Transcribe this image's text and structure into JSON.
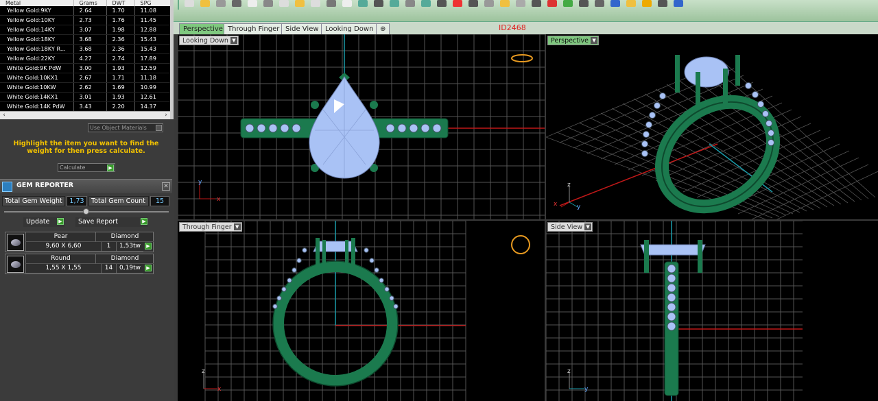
{
  "metal_table": {
    "headers": [
      "Metal",
      "Grams",
      "DWT",
      "SPG"
    ],
    "rows": [
      [
        "Yellow Gold:9KY",
        "2.64",
        "1.70",
        "11.08"
      ],
      [
        "Yellow Gold:10KY",
        "2.73",
        "1.76",
        "11.45"
      ],
      [
        "Yellow Gold:14KY",
        "3.07",
        "1.98",
        "12.88"
      ],
      [
        "Yellow Gold:18KY",
        "3.68",
        "2.36",
        "15.43"
      ],
      [
        "Yellow Gold:18KY R...",
        "3.68",
        "2.36",
        "15.43"
      ],
      [
        "Yellow Gold:22KY",
        "4.27",
        "2.74",
        "17.89"
      ],
      [
        "White Gold:9K PdW",
        "3.00",
        "1.93",
        "12.59"
      ],
      [
        "White Gold:10KX1",
        "2.67",
        "1.71",
        "11.18"
      ],
      [
        "White Gold:10KW",
        "2.62",
        "1.69",
        "10.99"
      ],
      [
        "White Gold:14KX1",
        "3.01",
        "1.93",
        "12.61"
      ],
      [
        "White Gold:14K PdW",
        "3.43",
        "2.20",
        "14.37"
      ]
    ]
  },
  "use_object_materials": "Use Object Materials",
  "hint": "Highlight the item you want to find the weight for then press calculate.",
  "calculate_label": "Calculate",
  "gem_reporter": {
    "title": "GEM REPORTER",
    "total_weight_label": "Total Gem Weight",
    "total_weight": "1,73",
    "total_count_label": "Total Gem Count",
    "total_count": "15",
    "update_label": "Update",
    "save_label": "Save Report",
    "gems": [
      {
        "shape": "Pear",
        "material": "Diamond",
        "size": "9,60 X 6,60",
        "count": "1",
        "weight": "1,53tw"
      },
      {
        "shape": "Round",
        "material": "Diamond",
        "size": "1,55 X 1,55",
        "count": "14",
        "weight": "0,19tw"
      }
    ]
  },
  "tabs": [
    "Perspective",
    "Through Finger",
    "Side View",
    "Looking Down",
    "⊕"
  ],
  "id_label": "ID2468",
  "viewports": {
    "top_left": "Looking Down",
    "top_right": "Perspective",
    "bottom_left": "Through Finger",
    "bottom_right": "Side View"
  },
  "axes": {
    "x": "x",
    "y": "y",
    "z": "z"
  },
  "colors": {
    "metal": "#1b7a4e",
    "gem": "#a9c2f5",
    "axis_red": "#c01818",
    "axis_cyan": "#1a9aa8",
    "grid": "#5a5a5a",
    "hint": "#f2c200"
  }
}
